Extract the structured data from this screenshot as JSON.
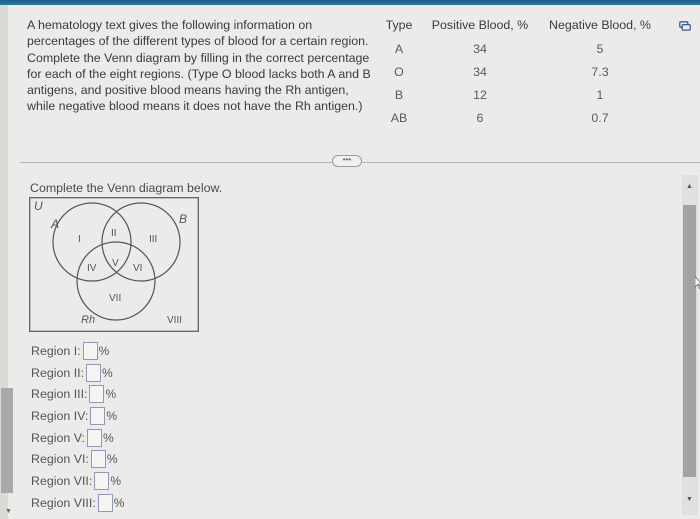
{
  "question": {
    "text": "A hematology text gives the following information on percentages of the different types of blood for a certain region. Complete the Venn diagram by filling in the correct percentage for each of the eight regions. (Type O blood lacks both A and B antigens, and positive blood means having the Rh antigen, while negative blood means it does not have the Rh antigen.)"
  },
  "table": {
    "headers": [
      "Type",
      "Positive Blood, %",
      "Negative Blood, %"
    ],
    "rows": [
      {
        "type": "A",
        "positive": "34",
        "negative": "5"
      },
      {
        "type": "O",
        "positive": "34",
        "negative": "7.3"
      },
      {
        "type": "B",
        "positive": "12",
        "negative": "1"
      },
      {
        "type": "AB",
        "positive": "6",
        "negative": "0.7"
      }
    ],
    "copy_icon": "copy-table-icon"
  },
  "divider": {
    "more_label": "•••"
  },
  "instruction": "Complete the Venn diagram below.",
  "venn": {
    "universe_label": "U",
    "set_a_label": "A",
    "set_b_label": "B",
    "set_rh_label": "Rh",
    "region_labels": [
      "I",
      "II",
      "III",
      "IV",
      "V",
      "VI",
      "VII",
      "VIII"
    ]
  },
  "regions": [
    {
      "label": "Region I:",
      "value": "",
      "unit": "%"
    },
    {
      "label": "Region II:",
      "value": "",
      "unit": "%"
    },
    {
      "label": "Region III:",
      "value": "",
      "unit": "%"
    },
    {
      "label": "Region IV:",
      "value": "",
      "unit": "%"
    },
    {
      "label": "Region V:",
      "value": "",
      "unit": "%"
    },
    {
      "label": "Region VI:",
      "value": "",
      "unit": "%"
    },
    {
      "label": "Region VII:",
      "value": "",
      "unit": "%"
    },
    {
      "label": "Region VIII:",
      "value": "",
      "unit": "%"
    }
  ],
  "scrollbar": {
    "up_arrow": "▲",
    "down_arrow": "▼"
  }
}
